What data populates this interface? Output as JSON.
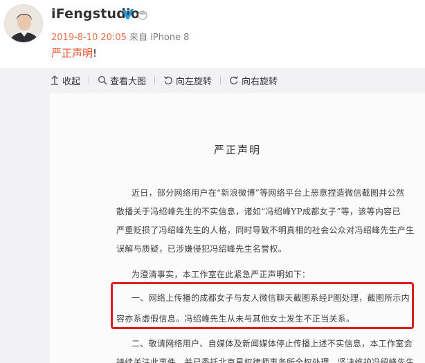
{
  "user": {
    "name": "iFengstudio",
    "verified_icon": "verified-v-icon",
    "vip_icon": "vip-badge-icon"
  },
  "meta": {
    "time": "2019-8-10 20:05",
    "from": " 来自 iPhone 8"
  },
  "post": {
    "link_text": "严正声明",
    "suffix": "!"
  },
  "toolbar": {
    "collapse": "收起",
    "view_large": "查看大图",
    "rotate_left": "向左旋转",
    "rotate_right": "向右旋转"
  },
  "document": {
    "title": "严正声明",
    "lines": [
      "近日，部分网络用户在“新浪微博”等网络平台上恶意捏造微信截图并公然",
      "散播关于冯绍峰先生的不实信息，诸如“冯绍峰YP成都女子”等，该等内容已",
      "严重贬损了冯绍峰先生的人格，同时导致不明真相的社会公众对冯绍峰先生产生",
      "误解与质疑，已涉嫌侵犯冯绍峰先生名誉权。",
      "为澄清事实，本工作室在此紧急严正声明如下：",
      "一、网络上传播的成都女子与友人微信聊天截图系经P图处理，截图所示内",
      "容亦系虚假信息。冯绍峰先生从未与其他女士发生不正当关系。",
      "二、敬请网络用户、自媒体及新闻媒体停止传播上述不实信息，本工作室会",
      "持续关注此事件，并已委托北京星权律师事务所全权处理，坚决维护冯绍峰先生"
    ]
  },
  "colors": {
    "link": "#eb4c2d",
    "time": "#eb7350",
    "highlight": "#e01e22",
    "panel_bg": "#f2f2f5"
  }
}
